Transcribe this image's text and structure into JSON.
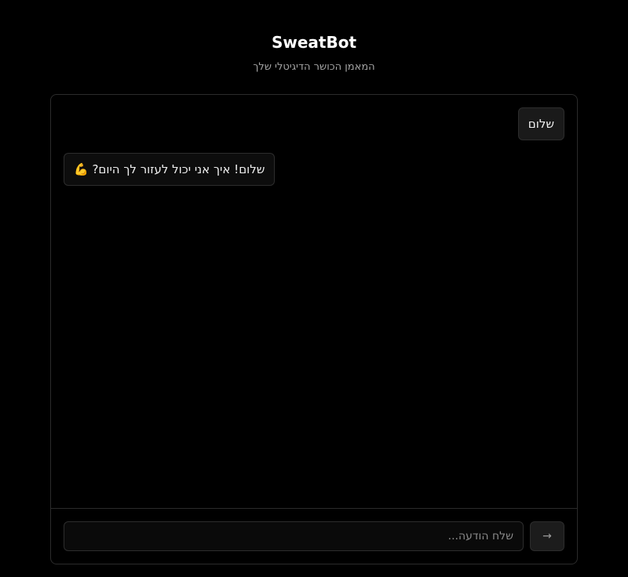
{
  "header": {
    "title": "SweatBot",
    "subtitle": "המאמן הכושר הדיגיטלי שלך"
  },
  "chat": {
    "messages": [
      {
        "role": "user",
        "text": "שלום"
      },
      {
        "role": "bot",
        "text": "שלום! איך אני יכול לעזור לך היום? 💪"
      }
    ]
  },
  "composer": {
    "placeholder": "שלח הודעה...",
    "value": "",
    "send_icon": "→"
  },
  "colors": {
    "background": "#000000",
    "border": "#2b2b2b",
    "text": "#ffffff",
    "muted": "#a3a3a3"
  }
}
